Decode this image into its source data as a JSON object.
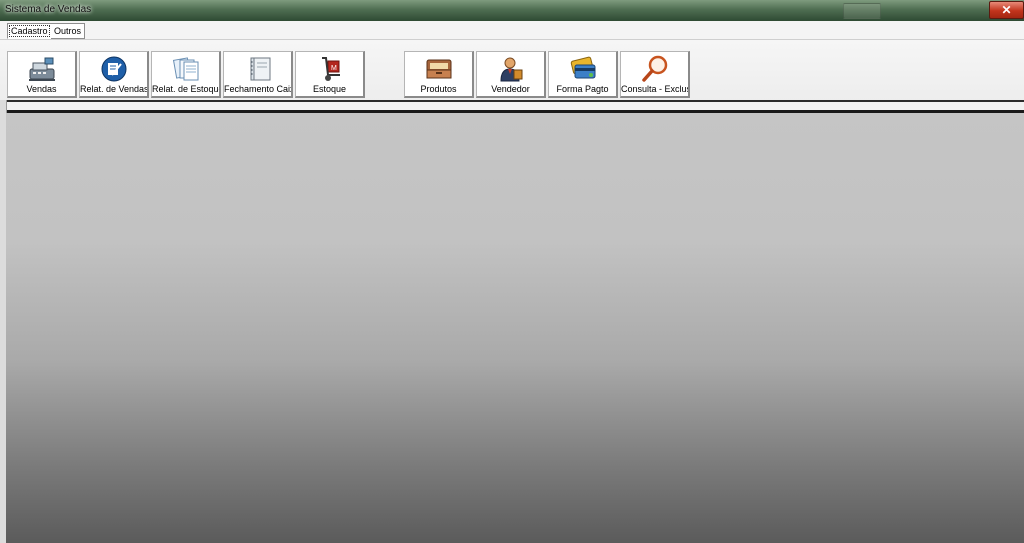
{
  "window": {
    "title": "Sistema de Vendas",
    "close_glyph": "✕"
  },
  "tabs": [
    {
      "label": "Cadastro"
    },
    {
      "label": "Outros"
    }
  ],
  "toolbar": {
    "buttons": [
      {
        "label": "Vendas",
        "icon": "cash-register-icon"
      },
      {
        "label": "Relat. de Vendas",
        "icon": "edit-report-icon"
      },
      {
        "label": "Relat. de Estoque",
        "icon": "documents-icon"
      },
      {
        "label": "Fechamento Caixa",
        "icon": "binder-icon"
      },
      {
        "label": "Estoque",
        "icon": "hand-truck-icon"
      },
      {
        "label": "Produtos",
        "icon": "inbox-tray-icon"
      },
      {
        "label": "Vendedor",
        "icon": "salesman-icon"
      },
      {
        "label": "Forma Pagto",
        "icon": "credit-card-icon"
      },
      {
        "label": "Consulta - Exclusã",
        "icon": "magnifier-icon"
      }
    ]
  },
  "colors": {
    "titlebar": "#4f6e52",
    "close_button": "#c2341c",
    "workspace_top": "#c5c5c5",
    "workspace_bottom": "#5b5b5b"
  }
}
